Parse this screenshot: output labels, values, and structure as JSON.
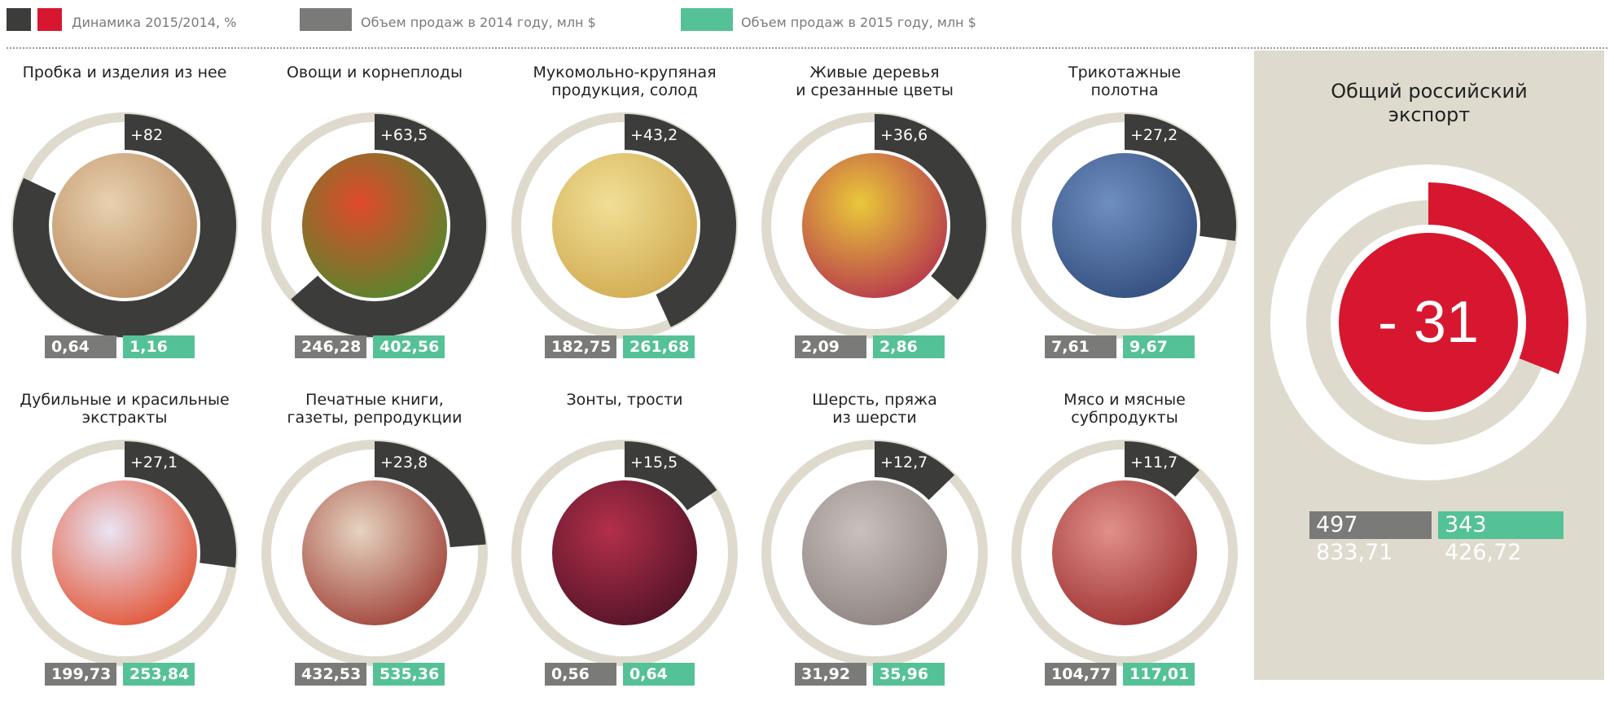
{
  "legend": {
    "dynamics": {
      "label": "Динамика 2015/2014, %"
    },
    "sales2014": {
      "label": "Объем продаж в 2014 году, млн $"
    },
    "sales2015": {
      "label": "Объем продаж в 2015 году, млн $"
    }
  },
  "colors": {
    "dark": "#3c3c3b",
    "red": "#d7172f",
    "grey": "#7a7a78",
    "green": "#55c196",
    "ring": "#dedbce",
    "panel": "#dedbce"
  },
  "chart_data": {
    "type": "donut",
    "items": [
      {
        "category": "Пробка и изделия из нее",
        "dynamics_label": "+82",
        "dynamics": 82,
        "sales2014_label": "0,64",
        "sales2015_label": "1,16",
        "sales2014": 0.64,
        "sales2015": 1.16,
        "photo": "corks-photo"
      },
      {
        "category": "Овощи и корнеплоды",
        "dynamics_label": "+63,5",
        "dynamics": 63.5,
        "sales2014_label": "246,28",
        "sales2015_label": "402,56",
        "sales2014": 246.28,
        "sales2015": 402.56,
        "photo": "vegetables-photo"
      },
      {
        "category": "Мукомольно-крупяная продукция, солод",
        "dynamics_label": "+43,2",
        "dynamics": 43.2,
        "sales2014_label": "182,75",
        "sales2015_label": "261,68",
        "sales2014": 182.75,
        "sales2015": 261.68,
        "photo": "grain-photo"
      },
      {
        "category": "Живые деревья и срезанные цветы",
        "dynamics_label": "+36,6",
        "dynamics": 36.6,
        "sales2014_label": "2,09",
        "sales2015_label": "2,86",
        "sales2014": 2.09,
        "sales2015": 2.86,
        "photo": "tulips-photo"
      },
      {
        "category": "Трикотажные полотна",
        "dynamics_label": "+27,2",
        "dynamics": 27.2,
        "sales2014_label": "7,61",
        "sales2015_label": "9,67",
        "sales2014": 7.61,
        "sales2015": 9.67,
        "photo": "knit-fabric-photo"
      },
      {
        "category": "Дубильные и красильные экстракты",
        "dynamics_label": "+27,1",
        "dynamics": 27.1,
        "sales2014_label": "199,73",
        "sales2015_label": "253,84",
        "sales2014": 199.73,
        "sales2015": 253.84,
        "photo": "paint-cans-photo"
      },
      {
        "category": "Печатные книги, газеты, репродукции",
        "dynamics_label": "+23,8",
        "dynamics": 23.8,
        "sales2014_label": "432,53",
        "sales2015_label": "535,36",
        "sales2014": 432.53,
        "sales2015": 535.36,
        "photo": "books-photo"
      },
      {
        "category": "Зонты, трости",
        "dynamics_label": "+15,5",
        "dynamics": 15.5,
        "sales2014_label": "0,56",
        "sales2015_label": "0,64",
        "sales2014": 0.56,
        "sales2015": 0.64,
        "photo": "umbrella-photo"
      },
      {
        "category": "Шерсть, пряжа из шерсти",
        "dynamics_label": "+12,7",
        "dynamics": 12.7,
        "sales2014_label": "31,92",
        "sales2015_label": "35,96",
        "sales2014": 31.92,
        "sales2015": 35.96,
        "photo": "wool-photo"
      },
      {
        "category": "Мясо и мясные субпродукты",
        "dynamics_label": "+11,7",
        "dynamics": 11.7,
        "sales2014_label": "104,77",
        "sales2015_label": "117,01",
        "sales2014": 104.77,
        "sales2015": 117.01,
        "photo": "meat-photo"
      }
    ],
    "total": {
      "category": "Общий российский экспорт",
      "dynamics_label": "- 31",
      "dynamics": -31,
      "sales2014_label": "497 833,71",
      "sales2015_label": "343 426,72",
      "sales2014": 497833.71,
      "sales2015": 343426.72
    }
  }
}
